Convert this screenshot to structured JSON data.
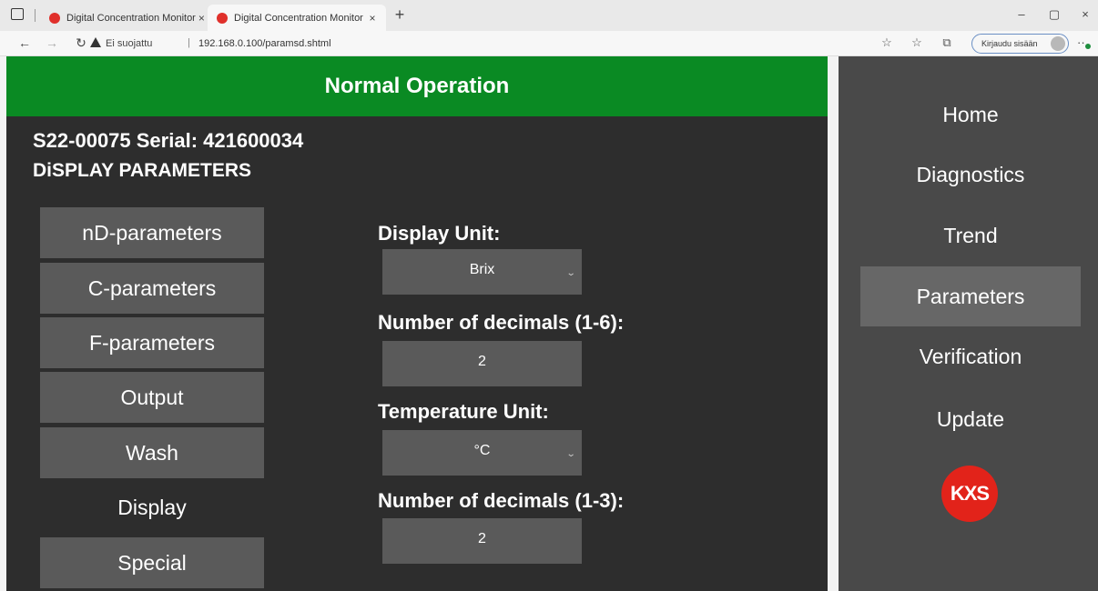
{
  "browser": {
    "tabs": [
      {
        "title": "Digital Concentration Monitor"
      },
      {
        "title": "Digital Concentration Monitor"
      }
    ],
    "tab_close": "×",
    "new_tab": "+",
    "window_controls": {
      "minimize": "–",
      "maximize": "▢",
      "close": "×"
    },
    "address": {
      "security_label": "Ei suojattu",
      "separator": "|",
      "url": "192.168.0.100/paramsd.shtml"
    },
    "signin_label": "Kirjaudu sisään",
    "more_label": "··"
  },
  "status": {
    "text": "Normal Operation",
    "color": "#0a8a23"
  },
  "device": {
    "id": "S22-00075 Serial: 421600034"
  },
  "section_title": "DiSPLAY PARAMETERS",
  "param_menu": [
    {
      "label": "nD-parameters"
    },
    {
      "label": "C-parameters"
    },
    {
      "label": "F-parameters"
    },
    {
      "label": "Output"
    },
    {
      "label": "Wash"
    },
    {
      "label": "Display",
      "active": true
    },
    {
      "label": "Special"
    }
  ],
  "fields": {
    "display_unit": {
      "label": "Display Unit:",
      "value": "Brix"
    },
    "decimals_1": {
      "label": "Number of decimals (1-6):",
      "value": "2"
    },
    "temperature_unit": {
      "label": "Temperature Unit:",
      "value": "°C"
    },
    "decimals_2": {
      "label": "Number of decimals (1-3):",
      "value": "2"
    }
  },
  "sidebar": {
    "items": [
      {
        "label": "Home"
      },
      {
        "label": "Diagnostics"
      },
      {
        "label": "Trend"
      },
      {
        "label": "Parameters",
        "active": true
      },
      {
        "label": "Verification"
      },
      {
        "label": "Update"
      }
    ],
    "logo_text": "KXS",
    "logo_color": "#e2231a"
  }
}
